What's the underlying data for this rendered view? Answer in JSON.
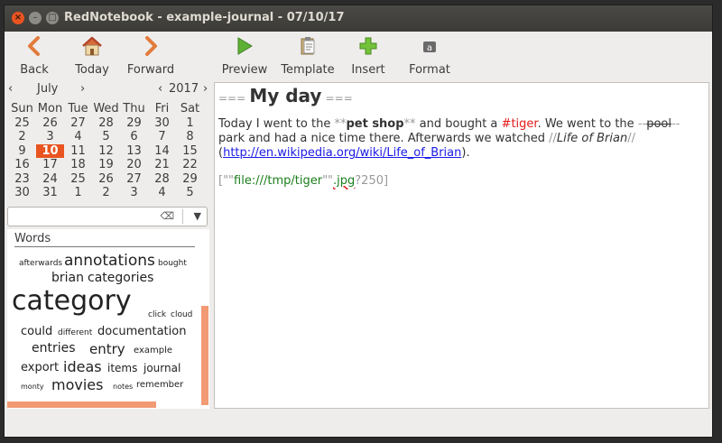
{
  "window": {
    "title": "RedNotebook - example-journal - 07/10/17",
    "close_glyph": "×",
    "min_glyph": "–",
    "max_glyph": "□"
  },
  "toolbar": {
    "back": "Back",
    "today": "Today",
    "forward": "Forward",
    "preview": "Preview",
    "template": "Template",
    "insert": "Insert",
    "format": "Format"
  },
  "calendar": {
    "month": "July",
    "year": "2017",
    "prev": "‹",
    "next": "›",
    "weekdays": [
      "Mon",
      "Tue",
      "Wed",
      "Thu",
      "Fri",
      "Sat"
    ],
    "weeks": [
      [
        "25",
        "26",
        "27",
        "28",
        "29",
        "30",
        "1"
      ],
      [
        "2",
        "3",
        "4",
        "5",
        "6",
        "7",
        "8"
      ],
      [
        "9",
        "10",
        "11",
        "12",
        "13",
        "14",
        "15"
      ],
      [
        "16",
        "17",
        "18",
        "19",
        "20",
        "21",
        "22"
      ],
      [
        "23",
        "24",
        "25",
        "26",
        "27",
        "28",
        "29"
      ],
      [
        "30",
        "31",
        "1",
        "2",
        "3",
        "4",
        "5"
      ]
    ],
    "selected_day": "10"
  },
  "search": {
    "value": "",
    "clear_glyph": "⌫",
    "dropdown_glyph": "▼"
  },
  "cloud": {
    "header": "Words",
    "words": [
      "afterwards",
      "annotations",
      "bought",
      "brian",
      "categories",
      "category",
      "click",
      "cloud",
      "could",
      "different",
      "documentation",
      "entries",
      "entry",
      "example",
      "export",
      "ideas",
      "items",
      "journal",
      "monty",
      "movies",
      "notes",
      "remember"
    ]
  },
  "editor": {
    "heading_marks": "===",
    "heading": "My day",
    "t1": "Today I went to the ",
    "bold_open": "**",
    "bold_text": "pet shop",
    "bold_close": "**",
    "t2": " and bought a ",
    "tag": "#tiger",
    "t3": ". We went to the ",
    "strike_open": "--",
    "strike_text": "pool",
    "strike_close": "--",
    "t4": " park and had a nice time there. Afterwards we watched ",
    "ital_open": "//",
    "ital_text": "Life of Brian",
    "ital_close": "//",
    "t5": " (",
    "link": "http://en.wikipedia.org/wiki/Life_of_Brian",
    "t6": ").",
    "img_open": "[",
    "img_q1": "\"\"",
    "img_path": "file:///tmp/tiger",
    "img_q2": "\"\"",
    "img_ext": ".jpg",
    "img_rest": "?250]"
  }
}
